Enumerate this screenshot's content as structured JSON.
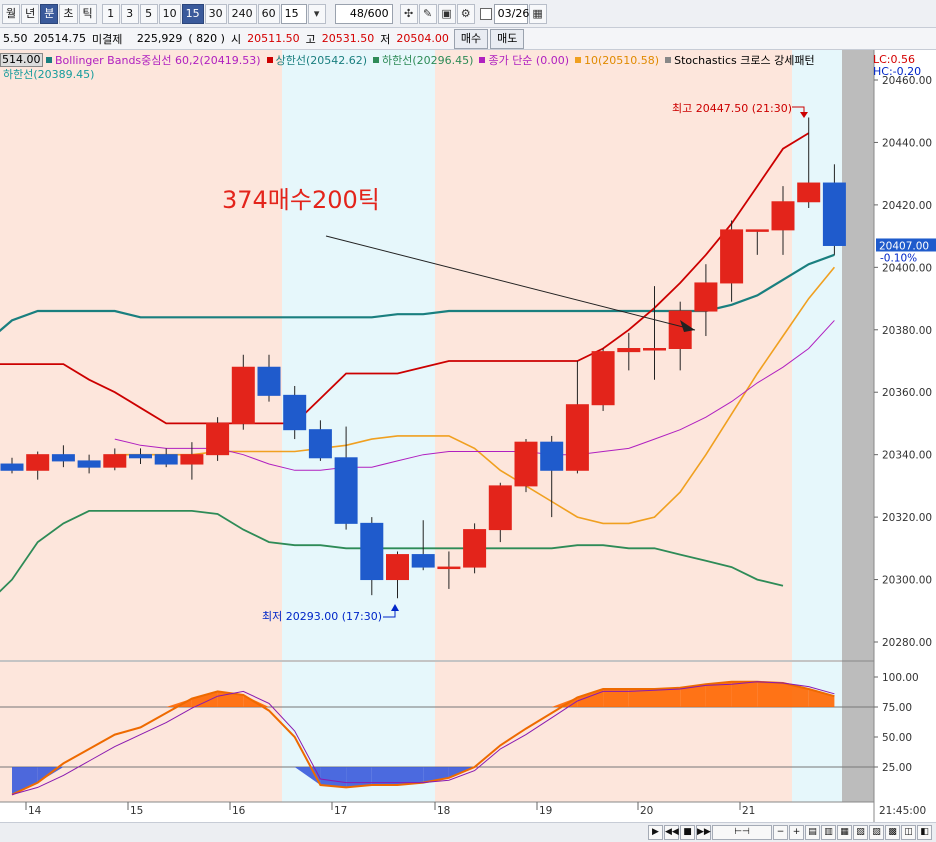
{
  "toolbar": {
    "periods": [
      "월",
      "년",
      "분",
      "초",
      "틱"
    ],
    "active_period": "분",
    "intervals": [
      "1",
      "3",
      "5",
      "10",
      "15",
      "30",
      "240",
      "60"
    ],
    "active_interval": "15",
    "interval_select": "15",
    "count": "48/600",
    "date": "03/26"
  },
  "quote": {
    "prev": "5.50",
    "current": "20514.75",
    "open_interest_label": "미결제",
    "open_interest": "225,929",
    "paren_value": "(    820  )",
    "open_label": "시",
    "open": "20511.50",
    "high_label": "고",
    "high": "20531.50",
    "low_label": "저",
    "low": "20504.00",
    "buy": "매수",
    "sell": "매도"
  },
  "legend": {
    "first": "514.00",
    "bb_mid": "Bollinger Bands중심선 60,2(20419.53)",
    "bb_upper": "상한선(20542.62)",
    "bb_lower": "하한선(20296.45)",
    "close_simple": "종가 단순 (0.00)",
    "ma10": "10(20510.58)",
    "stoch": "Stochastics 크로스 강세패턴",
    "second_line": "하한선(20389.45)",
    "lc": "LC:0.56",
    "hc": "HC:-0.20"
  },
  "annotations": {
    "note": "374매수200틱",
    "high_label": "최고 20447.50 (21:30)",
    "low_label": "최저 20293.00 (17:30)"
  },
  "price_axis": {
    "ticks": [
      "20460.00",
      "20440.00",
      "20420.00",
      "20400.00",
      "20380.00",
      "20360.00",
      "20340.00",
      "20320.00",
      "20300.00",
      "20280.00"
    ],
    "current": "20407.00",
    "current_change": "-0.10%"
  },
  "stoch_axis": {
    "ticks": [
      "100.00",
      "75.00",
      "50.00",
      "25.00"
    ]
  },
  "time_axis": {
    "labels": [
      "14",
      "15",
      "16",
      "17",
      "18",
      "19",
      "20",
      "21"
    ],
    "right_label": "21:45:00"
  },
  "colors": {
    "up": "#e3241b",
    "down": "#1f5bcc",
    "bb_mid": "#1a7f7f",
    "bb_upper": "#cc0000",
    "bb_lower": "#2e8b57",
    "ma": "#f0a020",
    "purple": "#b020c0",
    "session_a": "#fde6dc",
    "session_b": "#e6f7fb"
  },
  "candles": [
    {
      "o": 20337,
      "h": 20339,
      "l": 20334,
      "c": 20335
    },
    {
      "o": 20335,
      "h": 20341,
      "l": 20332,
      "c": 20340
    },
    {
      "o": 20340,
      "h": 20343,
      "l": 20336,
      "c": 20338
    },
    {
      "o": 20338,
      "h": 20340,
      "l": 20334,
      "c": 20336
    },
    {
      "o": 20336,
      "h": 20342,
      "l": 20335,
      "c": 20340
    },
    {
      "o": 20340,
      "h": 20342,
      "l": 20337,
      "c": 20339
    },
    {
      "o": 20340,
      "h": 20342,
      "l": 20336,
      "c": 20337
    },
    {
      "o": 20337,
      "h": 20344,
      "l": 20332,
      "c": 20340
    },
    {
      "o": 20340,
      "h": 20352,
      "l": 20338,
      "c": 20350
    },
    {
      "o": 20350,
      "h": 20372,
      "l": 20348,
      "c": 20368
    },
    {
      "o": 20368,
      "h": 20372,
      "l": 20357,
      "c": 20359
    },
    {
      "o": 20359,
      "h": 20362,
      "l": 20345,
      "c": 20348
    },
    {
      "o": 20348,
      "h": 20351,
      "l": 20338,
      "c": 20339
    },
    {
      "o": 20339,
      "h": 20349,
      "l": 20316,
      "c": 20318
    },
    {
      "o": 20318,
      "h": 20320,
      "l": 20295,
      "c": 20300
    },
    {
      "o": 20300,
      "h": 20309,
      "l": 20294,
      "c": 20308
    },
    {
      "o": 20308,
      "h": 20319,
      "l": 20303,
      "c": 20304
    },
    {
      "o": 20304,
      "h": 20309,
      "l": 20297,
      "c": 20304
    },
    {
      "o": 20304,
      "h": 20318,
      "l": 20302,
      "c": 20316
    },
    {
      "o": 20316,
      "h": 20331,
      "l": 20312,
      "c": 20330
    },
    {
      "o": 20330,
      "h": 20345,
      "l": 20328,
      "c": 20344
    },
    {
      "o": 20344,
      "h": 20346,
      "l": 20320,
      "c": 20335
    },
    {
      "o": 20335,
      "h": 20370,
      "l": 20334,
      "c": 20356
    },
    {
      "o": 20356,
      "h": 20374,
      "l": 20354,
      "c": 20373
    },
    {
      "o": 20373,
      "h": 20379,
      "l": 20367,
      "c": 20374
    },
    {
      "o": 20374,
      "h": 20394,
      "l": 20364,
      "c": 20374
    },
    {
      "o": 20374,
      "h": 20389,
      "l": 20367,
      "c": 20386
    },
    {
      "o": 20386,
      "h": 20401,
      "l": 20378,
      "c": 20395
    },
    {
      "o": 20395,
      "h": 20415,
      "l": 20389,
      "c": 20412
    },
    {
      "o": 20412,
      "h": 20412,
      "l": 20404,
      "c": 20412
    },
    {
      "o": 20412,
      "h": 20426,
      "l": 20404,
      "c": 20421
    },
    {
      "o": 20421,
      "h": 20448,
      "l": 20419,
      "c": 20427
    },
    {
      "o": 20427,
      "h": 20433,
      "l": 20404,
      "c": 20407
    }
  ],
  "bb_mid_line": [
    20376,
    20383,
    20386,
    20386,
    20386,
    20386,
    20384,
    20384,
    20384,
    20384,
    20384,
    20384,
    20384,
    20384,
    20384,
    20384,
    20385,
    20385,
    20386,
    20386,
    20386,
    20386,
    20386,
    20386,
    20386,
    20386,
    20386,
    20386,
    20386,
    20388,
    20391,
    20396,
    20401,
    20404
  ],
  "bb_upper_line": [
    20369,
    20369,
    20369,
    20369,
    20364,
    20360,
    20355,
    20350,
    20350,
    20350,
    20350,
    20350,
    20350,
    20358,
    20366,
    20366,
    20366,
    20368,
    20370,
    20370,
    20370,
    20370,
    20370,
    20370,
    20374,
    20380,
    20387,
    20395,
    20404,
    20414,
    20426,
    20438,
    20443
  ],
  "bb_lower_line": [
    20292,
    20300,
    20312,
    20318,
    20322,
    20322,
    20322,
    20322,
    20322,
    20321,
    20316,
    20312,
    20311,
    20311,
    20310,
    20310,
    20310,
    20310,
    20310,
    20310,
    20310,
    20310,
    20310,
    20311,
    20311,
    20310,
    20310,
    20308,
    20306,
    20304,
    20300,
    20298
  ],
  "ma10_line": [
    20340,
    20340,
    20340,
    20340,
    20341,
    20341,
    20341,
    20341,
    20342,
    20343,
    20345,
    20346,
    20346,
    20346,
    20342,
    20335,
    20330,
    20325,
    20320,
    20318,
    20318,
    20320,
    20328,
    20340,
    20353,
    20366,
    20378,
    20390,
    20400
  ],
  "purple_line": [
    20345,
    20343,
    20342,
    20342,
    20342,
    20340,
    20337,
    20335,
    20335,
    20336,
    20336,
    20338,
    20340,
    20341,
    20341,
    20341,
    20341,
    20340,
    20340,
    20341,
    20342,
    20345,
    20348,
    20352,
    20357,
    20363,
    20368,
    20374,
    20383
  ],
  "stoch_k": [
    2,
    12,
    28,
    40,
    52,
    58,
    70,
    82,
    88,
    85,
    72,
    50,
    10,
    8,
    10,
    10,
    12,
    16,
    25,
    43,
    57,
    70,
    83,
    90,
    90,
    90,
    91,
    94,
    96,
    96,
    95,
    90,
    84
  ],
  "stoch_d": [
    2,
    8,
    18,
    30,
    42,
    52,
    62,
    74,
    84,
    88,
    78,
    55,
    15,
    12,
    12,
    12,
    12,
    14,
    22,
    40,
    52,
    66,
    80,
    88,
    88,
    89,
    90,
    93,
    94,
    96,
    95,
    92,
    86
  ]
}
